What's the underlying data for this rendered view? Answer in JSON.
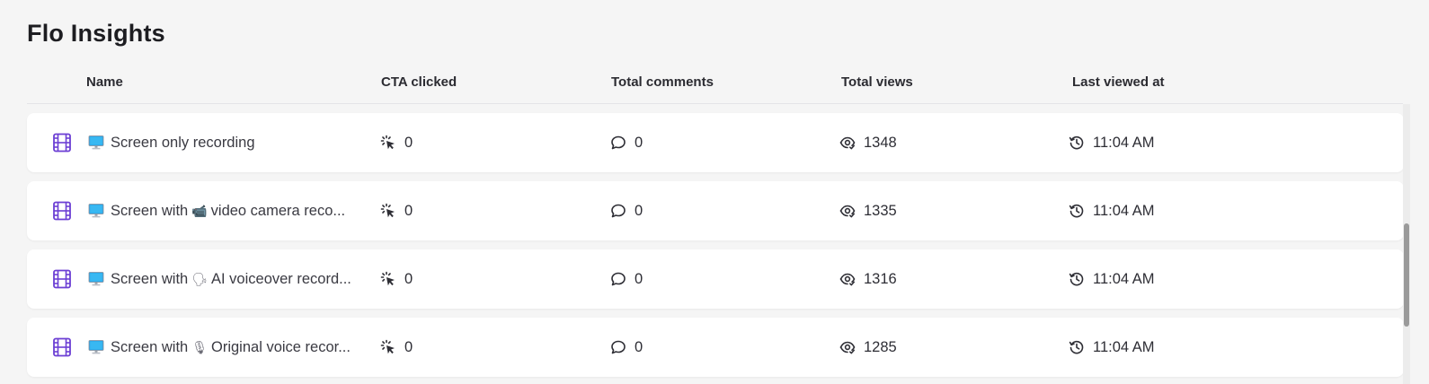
{
  "page": {
    "title": "Flo Insights"
  },
  "columns": {
    "name": "Name",
    "cta": "CTA clicked",
    "comments": "Total comments",
    "views": "Total views",
    "last_viewed": "Last viewed at"
  },
  "colors": {
    "accent": "#6c3fd4",
    "monitor_screen": "#29a6ea"
  },
  "rows": [
    {
      "name_a": "Screen only recording",
      "emoji": "",
      "name_b": "",
      "cta": "0",
      "comments": "0",
      "views": "1348",
      "last_viewed": "11:04 AM"
    },
    {
      "name_a": "Screen with",
      "emoji": "video-camera",
      "name_b": "video camera reco...",
      "cta": "0",
      "comments": "0",
      "views": "1335",
      "last_viewed": "11:04 AM"
    },
    {
      "name_a": "Screen with",
      "emoji": "speaking-head",
      "name_b": "AI voiceover record...",
      "cta": "0",
      "comments": "0",
      "views": "1316",
      "last_viewed": "11:04 AM"
    },
    {
      "name_a": "Screen with",
      "emoji": "microphone",
      "name_b": "Original voice recor...",
      "cta": "0",
      "comments": "0",
      "views": "1285",
      "last_viewed": "11:04 AM"
    }
  ]
}
